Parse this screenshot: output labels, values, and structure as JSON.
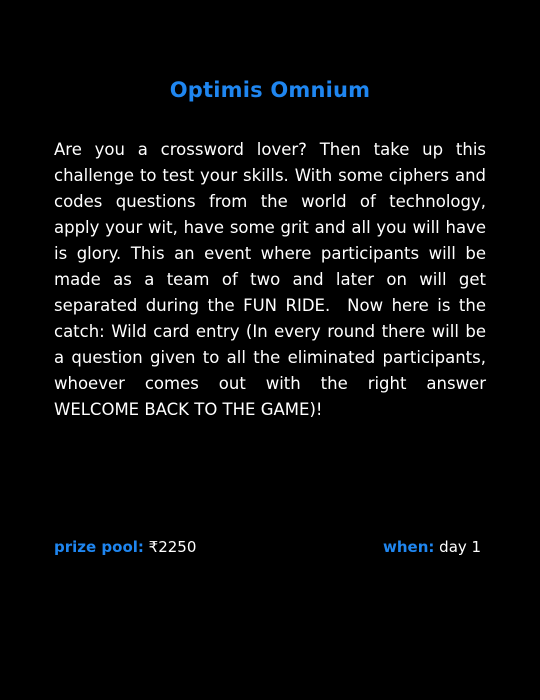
{
  "event": {
    "title": "Optimis Omnium",
    "description": "Are you a crossword lover? Then take up this challenge to test your skills. With some ciphers and codes questions from the world of technology, apply your wit, have some grit and all you will have is glory. This an event where participants will be made as a team of two and later on will get separated during the FUN RIDE.  Now here is the catch: Wild card entry (In every round there will be a question given to all the eliminated participants, whoever comes out with the right answer WELCOME BACK TO THE GAME)!",
    "prize_label": "prize pool:",
    "prize_value": "₹2250",
    "when_label": "when:",
    "when_value": "day 1"
  },
  "colors": {
    "background": "#000000",
    "accent": "#1f86f0",
    "text": "#ffffff"
  }
}
